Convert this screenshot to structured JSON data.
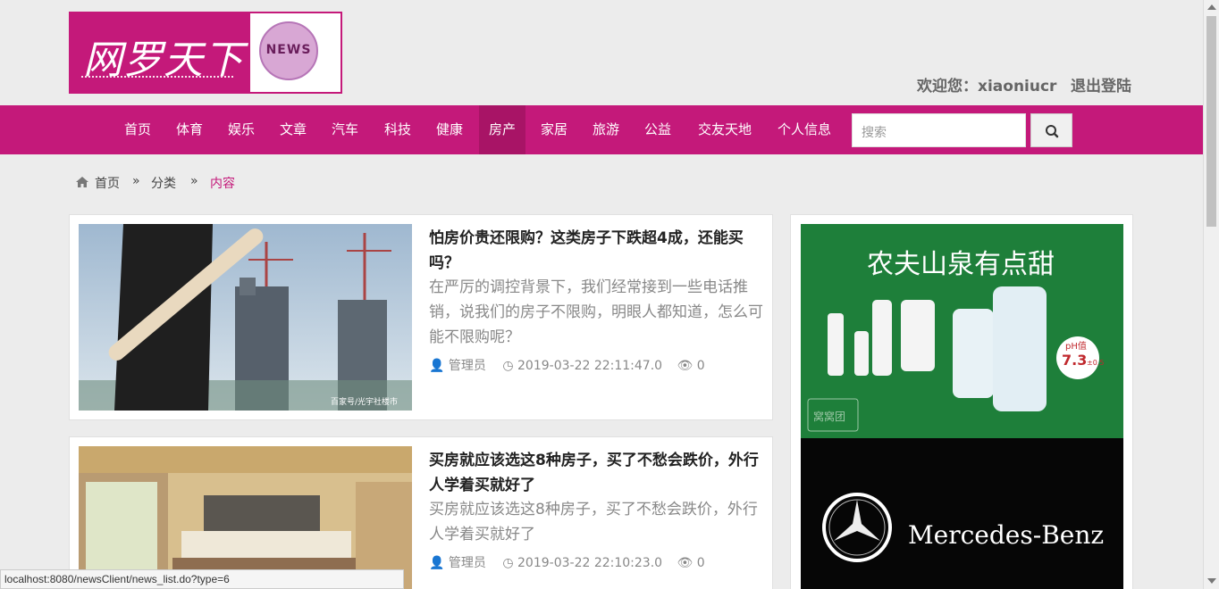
{
  "logo": {
    "text": "网罗天下",
    "badge": "NEWS"
  },
  "user": {
    "welcome": "欢迎您：xiaoniucr",
    "logout": "退出登陆"
  },
  "nav": {
    "items": [
      "首页",
      "体育",
      "娱乐",
      "文章",
      "汽车",
      "科技",
      "健康",
      "房产",
      "家居",
      "旅游",
      "公益",
      "交友天地",
      "个人信息"
    ],
    "active": "房产"
  },
  "search": {
    "placeholder": "搜索"
  },
  "breadcrumb": {
    "home": "首页",
    "sep": "»",
    "category": "分类",
    "current": "内容"
  },
  "articles": [
    {
      "title": "怕房价贵还限购？这类房子下跌超4成，还能买吗？",
      "summary": "在严厉的调控背景下，我们经常接到一些电话推销，说我们的房子不限购，明眼人都知道，怎么可能不限购呢？",
      "author": "管理员",
      "date": "2019-03-22 22:11:47.0",
      "views": "0",
      "watermark": "百家号/光宇社楼市"
    },
    {
      "title": "买房就应该选这8种房子，买了不愁会跌价，外行人学着买就好了",
      "summary": "买房就应该选这8种房子，买了不愁会跌价，外行人学着买就好了",
      "author": "管理员",
      "date": "2019-03-22 22:10:23.0",
      "views": "0"
    }
  ],
  "ads": [
    {
      "slogan": "农夫山泉有点甜",
      "ph_label": "pH值",
      "ph_value": "7.3",
      "ph_range": "±0.5",
      "brand_stamp": "窝窝团"
    },
    {
      "brand": "Mercedes-Benz"
    }
  ],
  "statusbar": {
    "url": "localhost:8080/newsClient/news_list.do?type=6"
  },
  "colors": {
    "brand": "#c4197a",
    "brand_dark": "#a81466",
    "background": "#ececec"
  }
}
